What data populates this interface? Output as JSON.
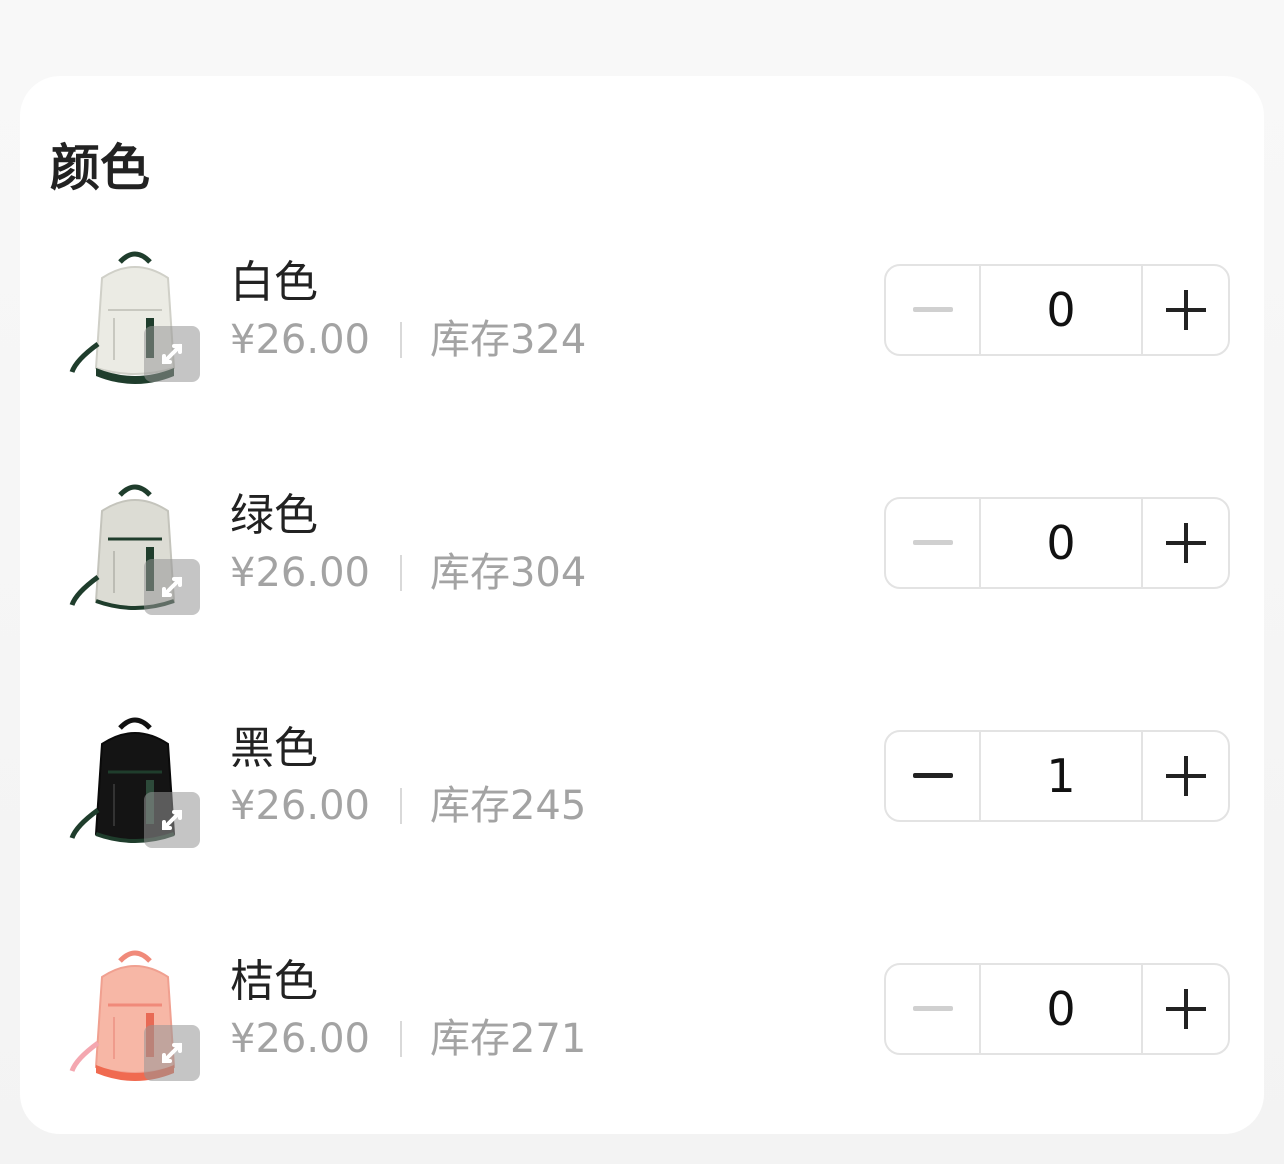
{
  "section": {
    "title": "颜色"
  },
  "colors": {
    "accent": "#222222",
    "muted_text": "#a3a3a3",
    "disabled_minus": "#d0d0d0",
    "active_minus": "#222222"
  },
  "variants": [
    {
      "name": "白色",
      "price": "¥26.00",
      "stock": "库存324",
      "quantity": "0",
      "minus_enabled": false,
      "image_icon": "white-backpack-thumbnail",
      "zoom_icon": "expand-icon"
    },
    {
      "name": "绿色",
      "price": "¥26.00",
      "stock": "库存304",
      "quantity": "0",
      "minus_enabled": false,
      "image_icon": "green-backpack-thumbnail",
      "zoom_icon": "expand-icon"
    },
    {
      "name": "黑色",
      "price": "¥26.00",
      "stock": "库存245",
      "quantity": "1",
      "minus_enabled": true,
      "image_icon": "black-backpack-thumbnail",
      "zoom_icon": "expand-icon"
    },
    {
      "name": "桔色",
      "price": "¥26.00",
      "stock": "库存271",
      "quantity": "0",
      "minus_enabled": false,
      "image_icon": "orange-backpack-thumbnail",
      "zoom_icon": "expand-icon"
    }
  ]
}
